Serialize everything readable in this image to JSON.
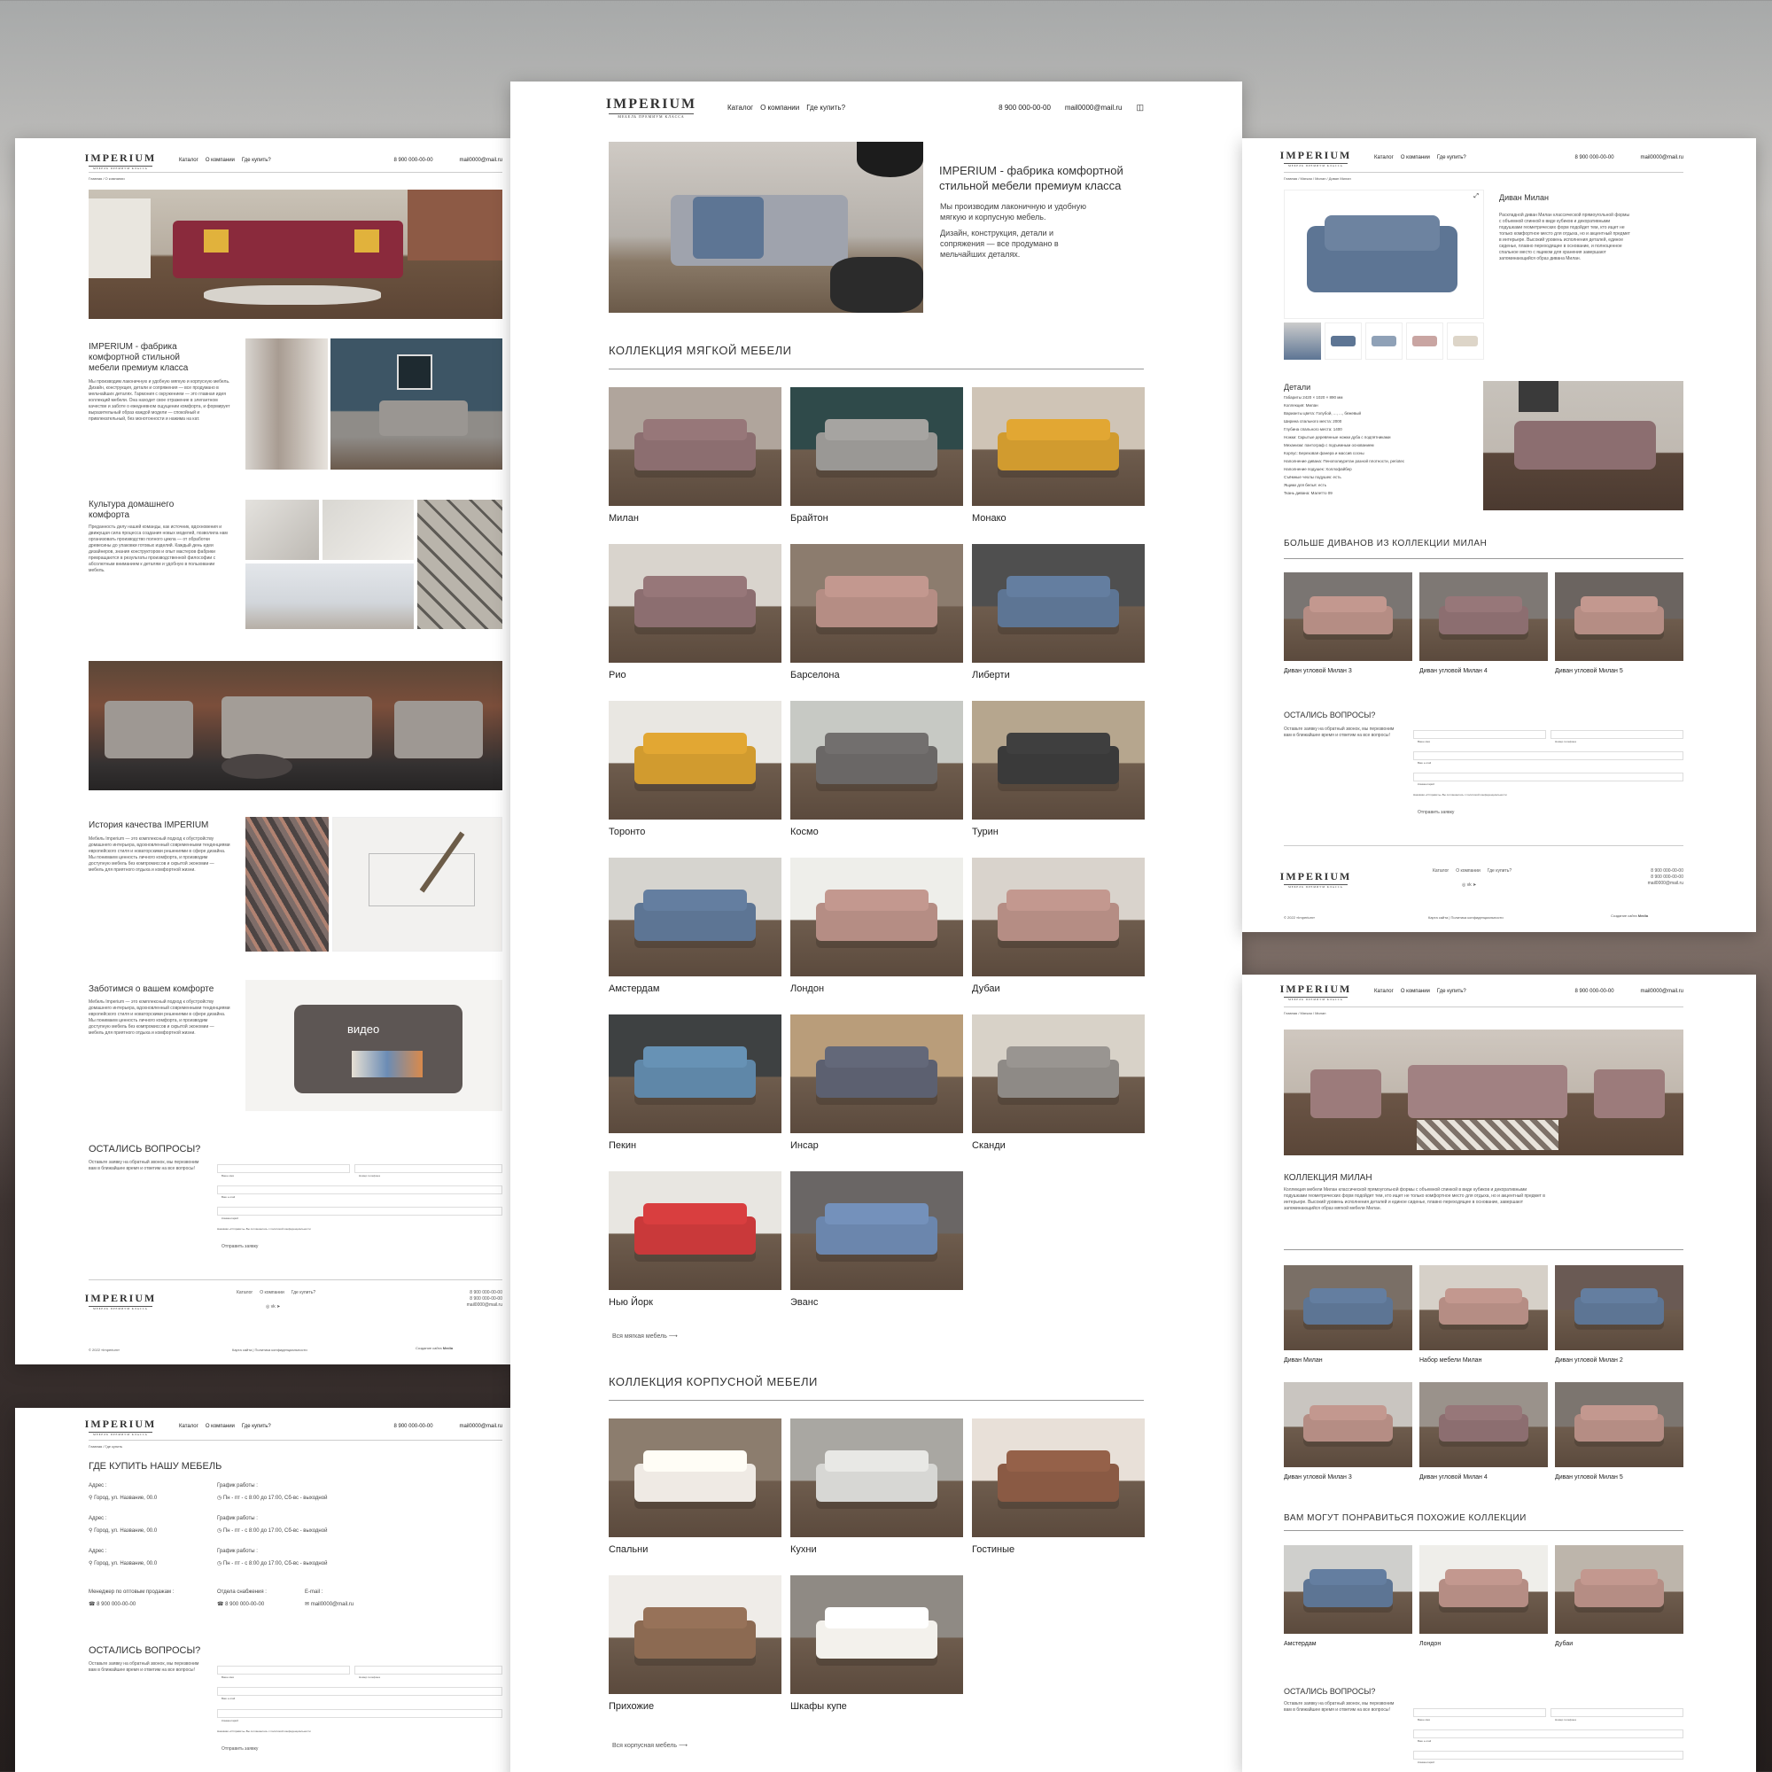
{
  "brand": {
    "logo": "IMPERIUM",
    "tagline": "МЕБЕЛЬ ПРЕМИУМ КЛАССА"
  },
  "nav": {
    "catalog": "Каталог",
    "about": "О компании",
    "where": "Где купить?",
    "phone": "8 900 000-00-00",
    "email": "mail0000@mail.ru"
  },
  "main": {
    "hero_title": "IMPERIUM - фабрика комфортной стильной мебели премиум класса",
    "hero_p1": "Мы производим лаконичную и удобную мягкую и корпусную мебель.",
    "hero_p2": "Дизайн, конструкция, детали и сопряжения — все продумано в мельчайших деталях.",
    "soft_title": "КОЛЛЕКЦИЯ МЯГКОЙ МЕБЕЛИ",
    "soft_items": [
      "Милан",
      "Брайтон",
      "Монако",
      "Рио",
      "Барселона",
      "Либерти",
      "Торонто",
      "Космо",
      "Турин",
      "Амстердам",
      "Лондон",
      "Дубаи",
      "Пекин",
      "Инсар",
      "Сканди",
      "Нью Йорк",
      "Эванс"
    ],
    "soft_more": "Вся мягкая мебель",
    "case_title": "КОЛЛЕКЦИЯ КОРПУСНОЙ МЕБЕЛИ",
    "case_items": [
      "Спальни",
      "Кухни",
      "Гостиные",
      "Прихожие",
      "Шкафы купе"
    ],
    "case_more": "Вся корпусная мебель"
  },
  "about": {
    "crumb": "Главная / О компании",
    "b1_title": "IMPERIUM - фабрика комфортной стильной мебели премиум класса",
    "b1_text": "Мы производим лаконичную и удобную мягкую и корпусную мебель. Дизайн, конструкция, детали и сопряжения — все продумано в мельчайших деталях. Гармония с окружением — это главная идея коллекций мебели. Она находит свое отражение в элегантном качестве и заботе о ежедневном ощущении комфорта, и формирует выразительный образ каждой модели — спокойный и привлекательный, без монотонности и нажима на кат.",
    "b2_title": "Культура домашнего комфорта",
    "b2_text": "Преданность делу нашей команды, как источник, вдохновения и движущая сила процесса создания новых моделей, позволила нам организовать производство полного цикла — от обработки древесины до упаковки готовых изделий. Каждый день идеи дизайнеров, знания конструкторов и опыт мастеров фабрики превращаются в результаты производственной философии с абсолютным вниманием к деталям и удобную в пользовании мебель.",
    "b3_title": "История качества IMPERIUM",
    "b3_text": "Мебель Imperium — это комплексный подход к обустройству домашнего интерьера, вдохновленный современными тенденциями европейского стиля и новаторскими решениями в сфере дизайна. Мы понимаем ценность личного комфорта, и производим доступную мебель без компромиссов и скрытой экономии — мебель для приятного отдыха и комфортной жизни.",
    "b4_title": "Заботимся о вашем комфорте",
    "b4_text": "Мебель Imperium — это комплексный подход к обустройству домашнего интерьера, вдохновленный современными тенденциями европейского стиля и новаторскими решениями в сфере дизайна. Мы понимаем ценность личного комфорта, и производим доступную мебель без компромиссов и скрытой экономии — мебель для приятного отдыха и комфортной жизни.",
    "video": "видео"
  },
  "form": {
    "title": "ОСТАЛИСЬ ВОПРОСЫ?",
    "text": "Оставьте заявку на обратный звонок, мы перезвоним вам в ближайшее время и ответим на все вопросы!",
    "name": "Ваше имя",
    "phone": "Номер телефона",
    "mail": "Ваш e-mail",
    "comment": "Комментарий",
    "consent": "Нажимая «Отправить» Вы соглашаетесь с политикой конфиденциальности",
    "submit": "Отправить заявку"
  },
  "footer": {
    "copy": "© 2022 «Imperium»",
    "links": "Карта сайта | Политика конфиденциальности",
    "made": "Создание сайта",
    "maker": "Media",
    "phone2": "8 900 000-00-00"
  },
  "where": {
    "crumb": "Главная / Где купить",
    "title": "ГДЕ КУПИТЬ НАШУ МЕБЕЛЬ",
    "addr_label": "Адрес :",
    "addr": "Город, ул. Название, 00.0",
    "hours_label": "График работы :",
    "hours": "Пн - пт - с 8:00 до 17:00, Сб-вс - выходной",
    "mgr_label": "Менеджер по оптовым продажам :",
    "supply_label": "Отдела снабжения :",
    "email_label": "E-mail :"
  },
  "product": {
    "crumb": "Главная / Мягкая / Милан / Диван Милан",
    "title": "Диван Милан",
    "desc": "Раскладной диван Милан классической прямоугольной формы с объемной спинкой в виде кубиков и декоративными подушками геометрических форм подойдет тем, кто ищет не только комфортное место для отдыха, но и акцентный предмет в интерьере. Высокий уровень исполнения деталей, единое сиденье, плавно переходящее в основание, и полноценное спальное место с ящиком для хранения завершают запоминающийся образ дивана Милан.",
    "details_title": "Детали",
    "details": [
      "Габариты 2420 × 1020 × 890 мм",
      "Коллекция: Милан",
      "Варианты цвета: Голубой, ..., ..., бежевый",
      "Ширина спального места: 2000",
      "Глубина спального места: 1400",
      "Ножки: Скрытые деревянные ножки дуба с подпятниками",
      "Механизм: пантограф с подъемным основанием",
      "Корпус: Березовая фанера и массив сосны",
      "Наполнение дивана: Пенополиуретан разной плотности, periotec",
      "Наполнение подушек: Холлофайбер",
      "Съёмные чехлы подушек: есть",
      "Ящики для белья: есть",
      "Ткань дивана: Малетто 09"
    ],
    "more_title": "БОЛЬШЕ ДИВАНОВ ИЗ КОЛЛЕКЦИИ МИЛАН",
    "more_items": [
      "Диван угловой Милан 3",
      "Диван угловой Милан 4",
      "Диван угловой Милан 5"
    ]
  },
  "collection": {
    "crumb": "Главная / Мягкая / Милан",
    "title": "КОЛЛЕКЦИЯ МИЛАН",
    "desc": "Коллекция мебели Милан классической прямоугольной формы с объемной спинкой в виде кубиков и декоративными подушками геометрических форм подойдет тем, кто ищет не только комфортное место для отдыха, но и акцентный предмет в интерьере. Высокий уровень исполнения деталей и единое сиденье, плавно переходящее в основание, завершают запоминающийся образ мягкой мебели Милан.",
    "items": [
      "Диван Милан",
      "Набор мебели Милан",
      "Диван угловой Милан 2",
      "Диван угловой Милан 3",
      "Диван угловой Милан 4",
      "Диван угловой Милан 5"
    ],
    "similar_title": "ВАМ МОГУТ ПОНРАВИТЬСЯ ПОХОЖИЕ КОЛЛЕКЦИИ",
    "similar": [
      "Амстердам",
      "Лондон",
      "Дубаи"
    ]
  },
  "colors": {
    "bordo": "#8a2a3c",
    "blue": "#5d7594",
    "mauve": "#8c6e70",
    "gray": "#8e8a86",
    "mustard": "#d19b2f",
    "pink": "#b58d84",
    "red": "#c9393a",
    "dark": "#3a3a3a"
  }
}
